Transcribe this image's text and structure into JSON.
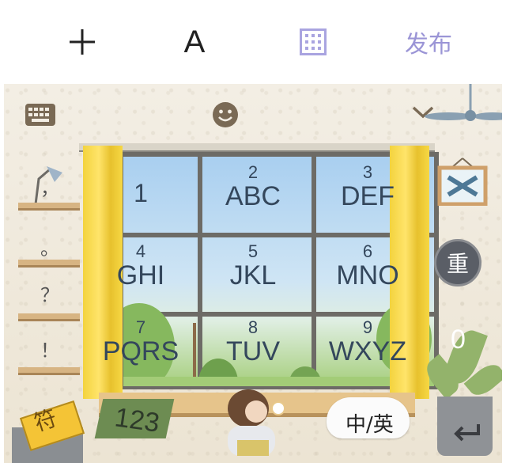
{
  "toolbar": {
    "font_label": "A",
    "publish_label": "发布"
  },
  "keyboard": {
    "keys": [
      {
        "num": "1",
        "letters": ""
      },
      {
        "num": "2",
        "letters": "ABC"
      },
      {
        "num": "3",
        "letters": "DEF"
      },
      {
        "num": "4",
        "letters": "GHI"
      },
      {
        "num": "5",
        "letters": "JKL"
      },
      {
        "num": "6",
        "letters": "MNO"
      },
      {
        "num": "7",
        "letters": "PQRS"
      },
      {
        "num": "8",
        "letters": "TUV"
      },
      {
        "num": "9",
        "letters": "WXYZ"
      }
    ],
    "punctuation": [
      "，",
      "。",
      "？",
      "！"
    ],
    "zero_label": "0",
    "reenter_label": "重",
    "numbers_label": "123",
    "lang_toggle_label": "中/英",
    "symbols_label": "符"
  },
  "colors": {
    "publish": "#9b95d6",
    "grid_icon": "#a9a4e0",
    "key_text": "#34475c",
    "curtain": "#f3d33e"
  }
}
